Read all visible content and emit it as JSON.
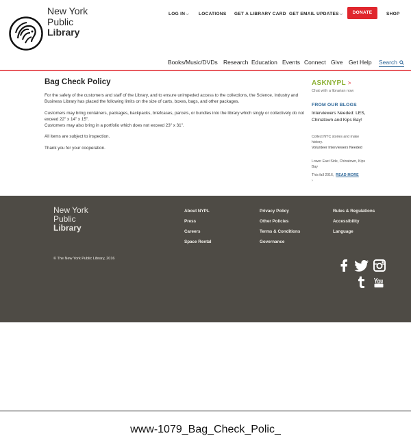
{
  "logo": {
    "line1": "New York",
    "line2": "Public",
    "line3": "Library"
  },
  "topnav": {
    "login": "LOG IN",
    "locations": "LOCATIONS",
    "card": "GET A LIBRARY CARD",
    "email": "GET EMAIL UPDATES",
    "donate": "DONATE",
    "shop": "SHOP"
  },
  "mainnav": [
    "Books/Music/DVDs",
    "Research",
    "Education",
    "Events",
    "Connect",
    "Give",
    "Get Help",
    "Search"
  ],
  "page": {
    "title": "Bag Check Policy",
    "paragraphs": [
      "For the safety of the customers and staff of the Library, and to ensure unimpeded access to the collections, the Science, Industry and Business Library has placed the following limits on the size of carts, boxes, bags, and other packages.",
      "Customers may bring containers, packages, backpacks, briefcases, parcels, or bundles into the library which singly or collectively do not exceed 22\" x 14\" x 15\".",
      "Customers may also bring in a portfolio which does not exceed 23\" x 31\".",
      "All items are subject to inspection.",
      "Thank you for your cooperation."
    ]
  },
  "sidebar": {
    "ask_brand_a": "ASK",
    "ask_brand_b": "NYPL",
    "ask_arrow": ">",
    "ask_sub": "Chat with a librarian now",
    "blogs_heading": "FROM OUR BLOGS",
    "blog_title": "Interviewers Needed: LES, Chinatown and Kips Bay!",
    "blog_desc": "Collect NYC stories and make history.",
    "blog_author": "Volunteer Interviewers Needed",
    "blog_loc": "Lower East Side, Chinatown, Kips Bay",
    "blog_date": "This fall 2016,",
    "read_more": "READ MORE",
    "blog_extra": "›"
  },
  "footer": {
    "logo": {
      "line1": "New York",
      "line2": "Public",
      "line3": "Library"
    },
    "col1": [
      "About NYPL",
      "Press",
      "Careers",
      "Space Rental"
    ],
    "col2": [
      "Privacy Policy",
      "Other Policies",
      "Terms & Conditions",
      "Governance"
    ],
    "col3": [
      "Rules & Regulations",
      "Accessibility",
      "Language"
    ],
    "copyright": "© The New York Public Library, 2016",
    "social_icons": [
      "facebook-icon",
      "twitter-icon",
      "instagram-icon",
      "tumblr-icon",
      "youtube-icon"
    ]
  },
  "caption": "www-1079_Bag_Check_Polic_",
  "colors": {
    "accent_red": "#e0262d",
    "link_blue": "#2a6496",
    "ask_green": "#8cb033",
    "footer_bg": "#4e4b45"
  }
}
